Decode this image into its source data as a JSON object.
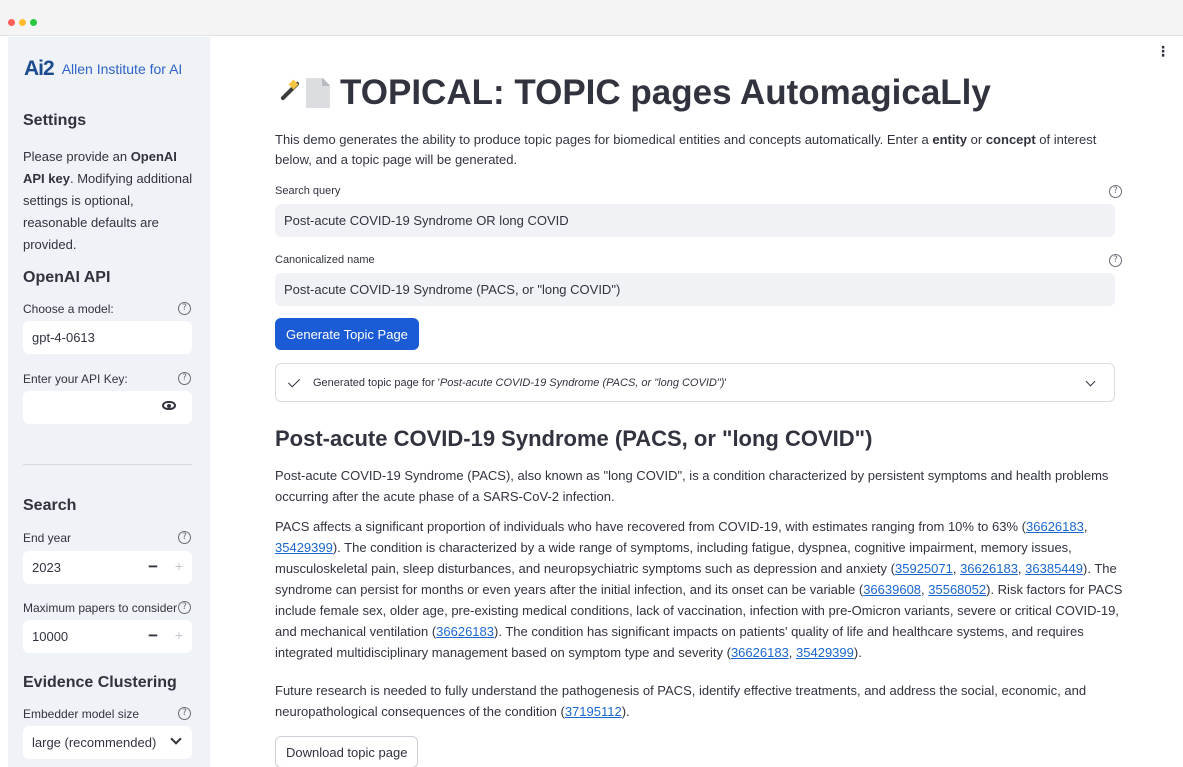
{
  "sidebar": {
    "logo_mark": "Ai2",
    "logo_text": "Allen Institute for AI",
    "settings_heading": "Settings",
    "settings_text_1": "Please provide an ",
    "settings_text_bold": "OpenAI API key",
    "settings_text_2": ". Modifying additional settings is optional, reasonable defaults are provided.",
    "openai_heading": "OpenAI API",
    "model_label": "Choose a model:",
    "model_value": "gpt-4-0613",
    "api_key_label": "Enter your API Key:",
    "api_key_value": "",
    "search_heading": "Search",
    "end_year_label": "End year",
    "end_year_value": "2023",
    "max_papers_label": "Maximum papers to consider",
    "max_papers_value": "10000",
    "clustering_heading": "Evidence Clustering",
    "embedder_label": "Embedder model size",
    "embedder_value": "large (recommended)",
    "help_glyph": "?",
    "minus_glyph": "−",
    "plus_glyph": "+"
  },
  "main": {
    "menu_glyph": "⋮",
    "title": "TOPICAL: TOPIC pages AutomagicaLly",
    "intro_1": "This demo generates the ability to produce topic pages for biomedical entities and concepts automatically. Enter a ",
    "intro_entity": "entity",
    "intro_2": " or ",
    "intro_concept": "concept",
    "intro_3": " of interest below, and a topic page will be generated.",
    "search_query_label": "Search query",
    "search_query_value": "Post-acute COVID-19 Syndrome  OR long COVID",
    "canonical_label": "Canonicalized name",
    "canonical_value": "Post-acute COVID-19 Syndrome (PACS, or \"long COVID\")",
    "generate_button": "Generate Topic Page",
    "status_prefix": "Generated topic page for '",
    "status_topic": "Post-acute COVID-19 Syndrome (PACS, or \"long COVID\")",
    "status_suffix": "'",
    "topic_heading": "Post-acute COVID-19 Syndrome (PACS, or \"long COVID\")",
    "para1": "Post-acute COVID-19 Syndrome (PACS), also known as \"long COVID\", is a condition characterized by persistent symptoms and health problems occurring after the acute phase of a SARS-CoV-2 infection.",
    "para2": {
      "t1": "PACS affects a significant proportion of individuals who have recovered from COVID-19, with estimates ranging from 10% to 63% (",
      "c1a": "36626183",
      "sep1": ", ",
      "c1b": "35429399",
      "t2": "). The condition is characterized by a wide range of symptoms, including fatigue, dyspnea, cognitive impairment, memory issues, musculoskeletal pain, sleep disturbances, and neuropsychiatric symptoms such as depression and anxiety (",
      "c2a": "35925071",
      "sep2": ", ",
      "c2b": "36626183",
      "sep3": ", ",
      "c2c": "36385449",
      "t3": "). The syndrome can persist for months or even years after the initial infection, and its onset can be variable (",
      "c3a": "36639608",
      "sep4": ", ",
      "c3b": "35568052",
      "t4": "). Risk factors for PACS include female sex, older age, pre-existing medical conditions, lack of vaccination, infection with pre-Omicron variants, severe or critical COVID-19, and mechanical ventilation (",
      "c4a": "36626183",
      "t5": "). The condition has significant impacts on patients' quality of life and healthcare systems, and requires integrated multidisciplinary management based on symptom type and severity (",
      "c5a": "36626183",
      "sep5": ", ",
      "c5b": "35429399",
      "t6": ")."
    },
    "para3": {
      "t1": "Future research is needed to fully understand the pathogenesis of PACS, identify effective treatments, and address the social, economic, and neuropathological consequences of the condition (",
      "c1": "37195112",
      "t2": ")."
    },
    "download_button": "Download topic page"
  }
}
